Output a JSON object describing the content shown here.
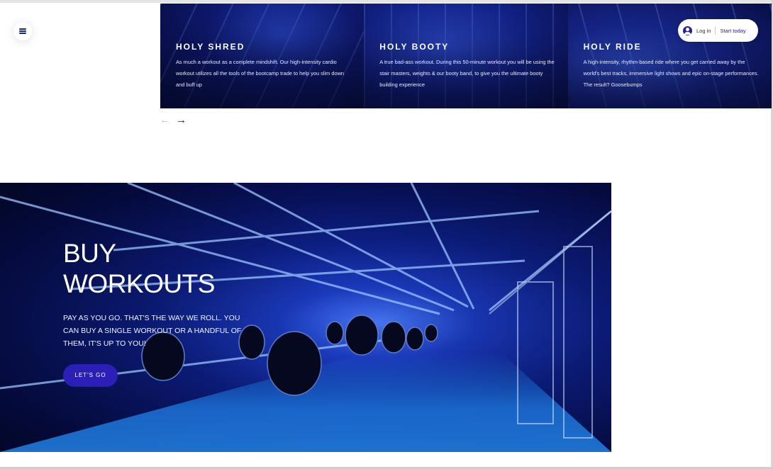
{
  "nav": {
    "menu_icon": "hamburger-menu-icon",
    "login_label": "Log in",
    "start_label": "Start today",
    "user_icon": "user-circle-icon"
  },
  "carousel": {
    "slides": [
      {
        "title": "HOLY SHRED",
        "description": "As much a workout as a complete mindshift. Our high-intensity cardio workout utilizes all the tools of the bootcamp trade to help you slim down and buff up"
      },
      {
        "title": "HOLY BOOTY",
        "description": "A true bad-ass workout. During this 50-minute workout you will be using the stair masters, weights & our booty band, to give you the ultimate booty building experience"
      },
      {
        "title": "HOLY RIDE",
        "description": "A high-intensity, rhythm-based ride where you get carried away by the world's best tracks, immersive light shows and epic on-stage performances. The result? Goosebumps"
      }
    ],
    "prev_icon": "arrow-left-icon",
    "next_icon": "arrow-right-icon",
    "prev_label": "←",
    "next_label": "→"
  },
  "hero": {
    "title": "BUY WORKOUTS",
    "description": "PAY AS YOU GO. THAT'S THE WAY WE ROLL. YOU CAN BUY A SINGLE WORKOUT OR A HANDFUL OF THEM, IT'S UP TO YOU!",
    "cta_label": "LET'S GO"
  },
  "colors": {
    "brand": "#2b1fb8",
    "navy": "#0d1f86",
    "bright_blue": "#4a7dff"
  }
}
